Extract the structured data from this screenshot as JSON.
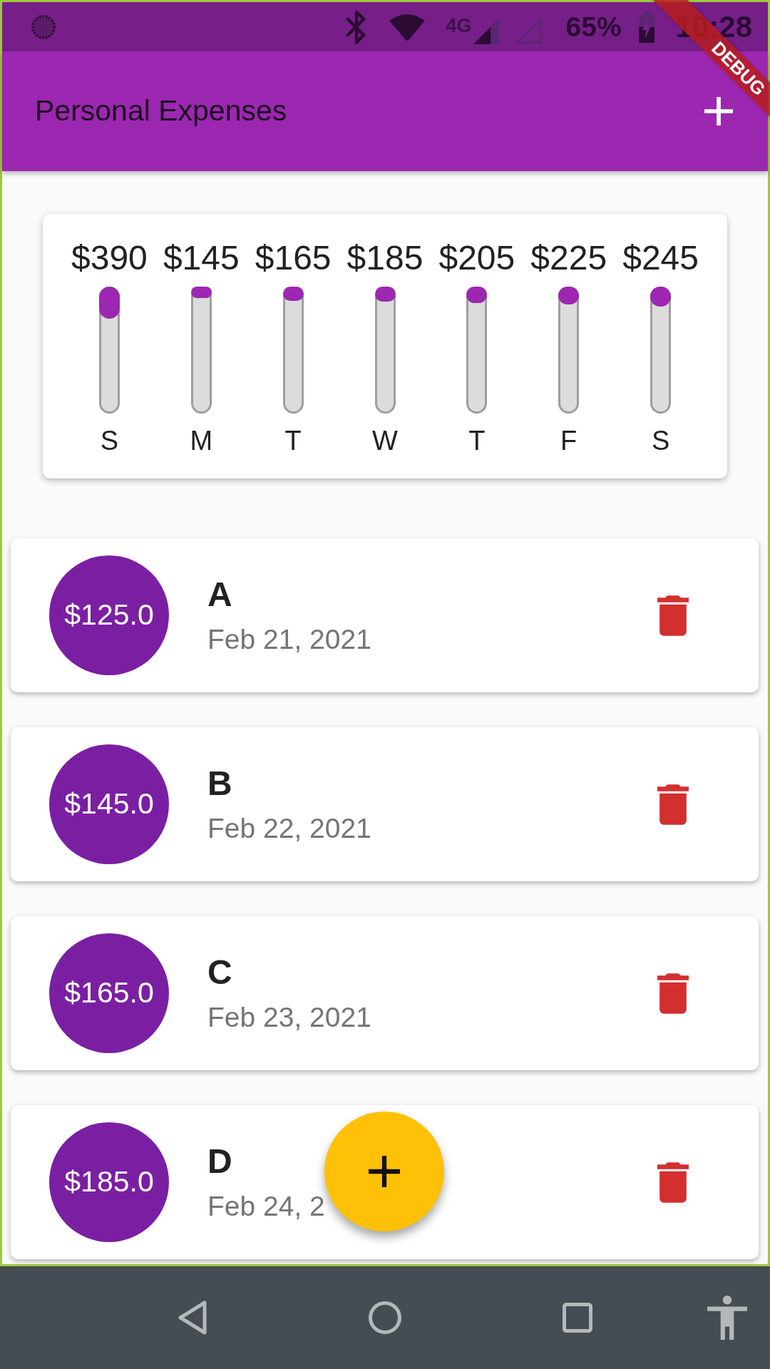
{
  "status_bar": {
    "network": "4G",
    "battery": "65%",
    "time": "10:28"
  },
  "debug_banner": {
    "label": "DEBUG"
  },
  "app_bar": {
    "title": "Personal Expenses"
  },
  "chart": {
    "bars": [
      {
        "amount": "$390",
        "day": "S",
        "level": 0.25
      },
      {
        "amount": "$145",
        "day": "M",
        "level": 0.09
      },
      {
        "amount": "$165",
        "day": "T",
        "level": 0.11
      },
      {
        "amount": "$185",
        "day": "W",
        "level": 0.12
      },
      {
        "amount": "$205",
        "day": "T",
        "level": 0.13
      },
      {
        "amount": "$225",
        "day": "F",
        "level": 0.14
      },
      {
        "amount": "$245",
        "day": "S",
        "level": 0.16
      }
    ]
  },
  "transactions": [
    {
      "amount": "$125.0",
      "title": "A",
      "date": "Feb 21, 2021"
    },
    {
      "amount": "$145.0",
      "title": "B",
      "date": "Feb 22, 2021"
    },
    {
      "amount": "$165.0",
      "title": "C",
      "date": "Feb 23, 2021"
    },
    {
      "amount": "$185.0",
      "title": "D",
      "date": "Feb 24, 2"
    }
  ]
}
